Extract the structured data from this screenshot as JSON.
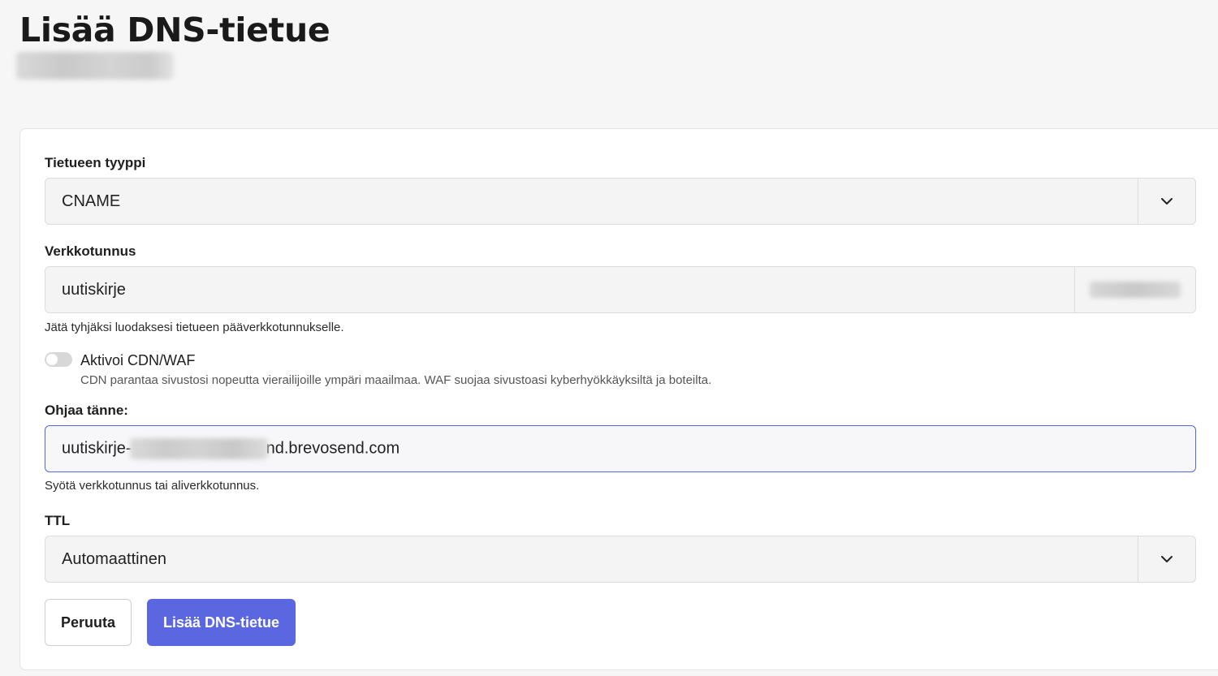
{
  "page": {
    "title": "Lisää DNS-tietue"
  },
  "form": {
    "record_type": {
      "label": "Tietueen tyyppi",
      "value": "CNAME"
    },
    "domain": {
      "label": "Verkkotunnus",
      "value": "uutiskirje",
      "help": "Jätä tyhjäksi luodaksesi tietueen pääverkkotunnukselle."
    },
    "cdn": {
      "label": "Aktivoi CDN/WAF",
      "description": "CDN parantaa sivustosi nopeutta vierailijoille ympäri maailmaa. WAF suojaa sivustoasi kyberhyökkäyksiltä ja boteilta.",
      "enabled": false
    },
    "target": {
      "label": "Ohjaa tänne:",
      "value_prefix": "uutiskirje-",
      "value_suffix": "nd.brevosend.com",
      "help": "Syötä verkkotunnus tai aliverkkotunnus."
    },
    "ttl": {
      "label": "TTL",
      "value": "Automaattinen"
    }
  },
  "actions": {
    "cancel_label": "Peruuta",
    "submit_label": "Lisää DNS-tietue"
  },
  "icons": {
    "select_arrow": "chevron-down-icon"
  },
  "colors": {
    "primary": "#5b67e0",
    "focus_border": "#5468d9",
    "background": "#f6f6f6"
  }
}
